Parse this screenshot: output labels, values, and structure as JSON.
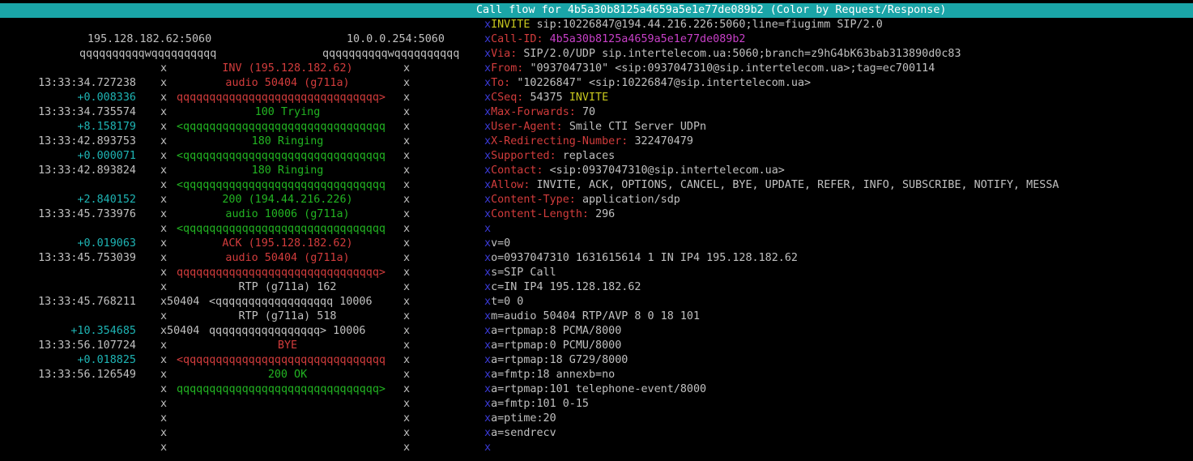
{
  "title": "Call flow for 4b5a30b8125a4659a5e1e77de089b2 (Color by Request/Response)",
  "hosts": {
    "left": "195.128.182.62:5060",
    "right": "10.0.0.254:5060",
    "left_line": "qqqqqqqqqqwqqqqqqqqqq",
    "right_line": "qqqqqqqqqqwqqqqqqqqqq"
  },
  "flow_rows": [
    {
      "ts": "",
      "delta": "",
      "left_edge": "x",
      "label": "INV (195.128.182.62)",
      "label_color": "red",
      "right_edge": "x"
    },
    {
      "ts": "13:33:34.727238",
      "delta": "",
      "left_edge": "x",
      "label": "audio 50404 (g711a)",
      "label_color": "red",
      "right_edge": "x"
    },
    {
      "ts": "",
      "delta": "+0.008336",
      "left_edge": "x",
      "label": "qqqqqqqqqqqqqqqqqqqqqqqqqqqqqqq>",
      "label_color": "red",
      "right_edge": "x"
    },
    {
      "ts": "13:33:34.735574",
      "delta": "",
      "left_edge": "x",
      "label": "100 Trying",
      "label_color": "green",
      "right_edge": "x"
    },
    {
      "ts": "",
      "delta": "+8.158179",
      "left_edge": "x",
      "label": "<qqqqqqqqqqqqqqqqqqqqqqqqqqqqqqq",
      "label_color": "green",
      "right_edge": "x"
    },
    {
      "ts": "13:33:42.893753",
      "delta": "",
      "left_edge": "x",
      "label": "180 Ringing",
      "label_color": "green",
      "right_edge": "x"
    },
    {
      "ts": "",
      "delta": "+0.000071",
      "left_edge": "x",
      "label": "<qqqqqqqqqqqqqqqqqqqqqqqqqqqqqqq",
      "label_color": "green",
      "right_edge": "x"
    },
    {
      "ts": "13:33:42.893824",
      "delta": "",
      "left_edge": "x",
      "label": "180 Ringing",
      "label_color": "green",
      "right_edge": "x"
    },
    {
      "ts": "",
      "delta": "",
      "left_edge": "x",
      "label": "<qqqqqqqqqqqqqqqqqqqqqqqqqqqqqqq",
      "label_color": "green",
      "right_edge": "x"
    },
    {
      "ts": "",
      "delta": "+2.840152",
      "left_edge": "x",
      "label": "200 (194.44.216.226)",
      "label_color": "green",
      "right_edge": "x"
    },
    {
      "ts": "13:33:45.733976",
      "delta": "",
      "left_edge": "x",
      "label": "audio 10006 (g711a)",
      "label_color": "green",
      "right_edge": "x"
    },
    {
      "ts": "",
      "delta": "",
      "left_edge": "x",
      "label": "<qqqqqqqqqqqqqqqqqqqqqqqqqqqqqqq",
      "label_color": "green",
      "right_edge": "x"
    },
    {
      "ts": "",
      "delta": "+0.019063",
      "left_edge": "x",
      "label": "ACK (195.128.182.62)",
      "label_color": "red",
      "right_edge": "x"
    },
    {
      "ts": "13:33:45.753039",
      "delta": "",
      "left_edge": "x",
      "label": "audio 50404 (g711a)",
      "label_color": "red",
      "right_edge": "x"
    },
    {
      "ts": "",
      "delta": "",
      "left_edge": "x",
      "label": "qqqqqqqqqqqqqqqqqqqqqqqqqqqqqqq>",
      "label_color": "red",
      "right_edge": "x"
    },
    {
      "ts": "",
      "delta": "",
      "left_edge": "x",
      "label": "RTP (g711a) 162",
      "label_color": "white",
      "right_edge": "x"
    },
    {
      "ts": "13:33:45.768211",
      "delta": "",
      "left_edge": "x50404",
      "label": "<qqqqqqqqqqqqqqqqqq 10006",
      "label_color": "white",
      "right_edge": "x"
    },
    {
      "ts": "",
      "delta": "",
      "left_edge": "x",
      "label": "RTP (g711a) 518",
      "label_color": "white",
      "right_edge": "x"
    },
    {
      "ts": "",
      "delta": "+10.354685",
      "left_edge": "x50404",
      "label": "qqqqqqqqqqqqqqqqq> 10006",
      "label_color": "white",
      "right_edge": "x"
    },
    {
      "ts": "13:33:56.107724",
      "delta": "",
      "left_edge": "x",
      "label": "BYE",
      "label_color": "red",
      "right_edge": "x"
    },
    {
      "ts": "",
      "delta": "+0.018825",
      "left_edge": "x",
      "label": "<qqqqqqqqqqqqqqqqqqqqqqqqqqqqqqq",
      "label_color": "red",
      "right_edge": "x"
    },
    {
      "ts": "13:33:56.126549",
      "delta": "",
      "left_edge": "x",
      "label": "200 OK",
      "label_color": "green",
      "right_edge": "x"
    },
    {
      "ts": "",
      "delta": "",
      "left_edge": "x",
      "label": "qqqqqqqqqqqqqqqqqqqqqqqqqqqqqqq>",
      "label_color": "green",
      "right_edge": "x"
    },
    {
      "ts": "",
      "delta": "",
      "left_edge": "x",
      "label": "",
      "label_color": "white",
      "right_edge": "x"
    },
    {
      "ts": "",
      "delta": "",
      "left_edge": "x",
      "label": "",
      "label_color": "white",
      "right_edge": "x"
    },
    {
      "ts": "",
      "delta": "",
      "left_edge": "x",
      "label": "",
      "label_color": "white",
      "right_edge": "x"
    },
    {
      "ts": "",
      "delta": "",
      "left_edge": "x",
      "label": "",
      "label_color": "white",
      "right_edge": "x"
    }
  ],
  "message_lines": [
    [
      {
        "t": "INVITE ",
        "c": "yellow"
      },
      {
        "t": "sip:10226847@194.44.216.226:5060;line=fiugimm SIP/2.0",
        "c": "white"
      }
    ],
    [
      {
        "t": "Call-ID: ",
        "c": "red"
      },
      {
        "t": "4b5a30b8125a4659a5e1e77de089b2",
        "c": "magenta"
      }
    ],
    [
      {
        "t": "Via: ",
        "c": "red"
      },
      {
        "t": "SIP/2.0/UDP sip.intertelecom.ua:5060;branch=z9hG4bK63bab313890d0c83",
        "c": "white"
      }
    ],
    [
      {
        "t": "From: ",
        "c": "red"
      },
      {
        "t": "\"0937047310\" <sip:0937047310@sip.intertelecom.ua>;tag=ec700114",
        "c": "white"
      }
    ],
    [
      {
        "t": "To: ",
        "c": "red"
      },
      {
        "t": "\"10226847\" <sip:10226847@sip.intertelecom.ua>",
        "c": "white"
      }
    ],
    [
      {
        "t": "CSeq: ",
        "c": "red"
      },
      {
        "t": "54375 ",
        "c": "white"
      },
      {
        "t": "INVITE",
        "c": "yellow"
      }
    ],
    [
      {
        "t": "Max-Forwards: ",
        "c": "red"
      },
      {
        "t": "70",
        "c": "white"
      }
    ],
    [
      {
        "t": "User-Agent: ",
        "c": "red"
      },
      {
        "t": "Smile CTI Server UDPn",
        "c": "white"
      }
    ],
    [
      {
        "t": "X-Redirecting-Number: ",
        "c": "red"
      },
      {
        "t": "322470479",
        "c": "white"
      }
    ],
    [
      {
        "t": "Supported: ",
        "c": "red"
      },
      {
        "t": "replaces",
        "c": "white"
      }
    ],
    [
      {
        "t": "Contact: ",
        "c": "red"
      },
      {
        "t": "<sip:0937047310@sip.intertelecom.ua>",
        "c": "white"
      }
    ],
    [
      {
        "t": "Allow: ",
        "c": "red"
      },
      {
        "t": "INVITE, ACK, OPTIONS, CANCEL, BYE, UPDATE, REFER, INFO, SUBSCRIBE, NOTIFY, MESSA",
        "c": "white"
      }
    ],
    [
      {
        "t": "Content-Type: ",
        "c": "red"
      },
      {
        "t": "application/sdp",
        "c": "white"
      }
    ],
    [
      {
        "t": "Content-Length: ",
        "c": "red"
      },
      {
        "t": "296",
        "c": "white"
      }
    ],
    [],
    [
      {
        "t": "v=0",
        "c": "white"
      }
    ],
    [
      {
        "t": "o=0937047310 1631615614 1 IN IP4 195.128.182.62",
        "c": "white"
      }
    ],
    [
      {
        "t": "s=SIP Call",
        "c": "white"
      }
    ],
    [
      {
        "t": "c=IN IP4 195.128.182.62",
        "c": "white"
      }
    ],
    [
      {
        "t": "t=0 0",
        "c": "white"
      }
    ],
    [
      {
        "t": "m=audio 50404 RTP/AVP 8 0 18 101",
        "c": "white"
      }
    ],
    [
      {
        "t": "a=rtpmap:8 PCMA/8000",
        "c": "white"
      }
    ],
    [
      {
        "t": "a=rtpmap:0 PCMU/8000",
        "c": "white"
      }
    ],
    [
      {
        "t": "a=rtpmap:18 G729/8000",
        "c": "white"
      }
    ],
    [
      {
        "t": "a=fmtp:18 annexb=no",
        "c": "white"
      }
    ],
    [
      {
        "t": "a=rtpmap:101 telephone-event/8000",
        "c": "white"
      }
    ],
    [
      {
        "t": "a=fmtp:101 0-15",
        "c": "white"
      }
    ],
    [
      {
        "t": "a=ptime:20",
        "c": "white"
      }
    ],
    [
      {
        "t": "a=sendrecv",
        "c": "white"
      }
    ],
    []
  ],
  "message_border_char": "x",
  "colors": {
    "title_bg": "#1aa5a8",
    "request": "#d23c3c",
    "response": "#22b422",
    "delta": "#1eb4b4",
    "border": "#3a3ad8",
    "method": "#c8c81e",
    "callid": "#c840c8"
  }
}
